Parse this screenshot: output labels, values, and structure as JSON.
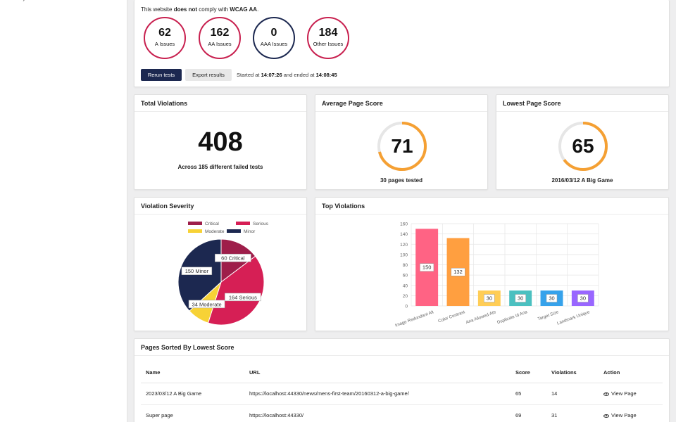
{
  "sidebar": {
    "crumb": "• ›"
  },
  "summary": {
    "comply_pre": "This website ",
    "comply_bold1": "does not",
    "comply_mid": " comply with ",
    "comply_bold2": "WCAG AA",
    "comply_post": ".",
    "issues": [
      {
        "count": "62",
        "label": "A Issues"
      },
      {
        "count": "162",
        "label": "AA Issues"
      },
      {
        "count": "0",
        "label": "AAA Issues"
      },
      {
        "count": "184",
        "label": "Other Issues"
      }
    ],
    "rerun_label": "Rerun tests",
    "export_label": "Export results",
    "started_pre": "Started at ",
    "started_time": "14:07:26",
    "ended_pre": " and ended at ",
    "ended_time": "14:08:45"
  },
  "total_violations": {
    "title": "Total Violations",
    "value": "408",
    "subtitle": "Across 185 different failed tests"
  },
  "average_score": {
    "title": "Average Page Score",
    "value": 71,
    "subtitle": "30 pages tested"
  },
  "lowest_score": {
    "title": "Lowest Page Score",
    "value": 65,
    "subtitle": "2016/03/12 A Big Game"
  },
  "severity": {
    "title": "Violation Severity"
  },
  "top_violations": {
    "title": "Top Violations"
  },
  "pages": {
    "title": "Pages Sorted By Lowest Score",
    "columns": {
      "name": "Name",
      "url": "URL",
      "score": "Score",
      "violations": "Violations",
      "action": "Action"
    },
    "rows": [
      {
        "name": "2023/03/12 A Big Game",
        "url": "https://localhost:44330/news/mens-first-team/20160312-a-big-game/",
        "score": "65",
        "violations": "14",
        "action": "View Page"
      },
      {
        "name": "Super page",
        "url": "https://localhost:44330/",
        "score": "69",
        "violations": "31",
        "action": "View Page"
      }
    ]
  },
  "colors": {
    "navy": "#1c2850",
    "crimson": "#c8204f",
    "ring_orange": "#f5a033",
    "ring_track": "#e6e6e6"
  },
  "chart_data": [
    {
      "type": "pie",
      "legend": [
        "Critical",
        "Serious",
        "Moderate",
        "Minor"
      ],
      "labels": [
        "60 Critical",
        "164 Serious",
        "34 Moderate",
        "150 Minor"
      ],
      "values": [
        60,
        164,
        34,
        150
      ],
      "colors": [
        "#9e1e4a",
        "#d61f55",
        "#f7d236",
        "#1c2850"
      ],
      "legend_position": "top"
    },
    {
      "type": "bar",
      "categories": [
        "Image Redundant Alt",
        "Color Contrast",
        "Aria Allowed Attr",
        "Duplicate Id Aria",
        "Target Size",
        "Landmark Unique"
      ],
      "values": [
        150,
        132,
        30,
        30,
        30,
        30
      ],
      "colors": [
        "#ff6384",
        "#ff9f40",
        "#ffcd56",
        "#4bc0c0",
        "#36a2eb",
        "#9966ff"
      ],
      "ylim": [
        0,
        160
      ],
      "yticks": [
        0,
        20,
        40,
        60,
        80,
        100,
        120,
        140,
        160
      ],
      "grid": true
    }
  ]
}
